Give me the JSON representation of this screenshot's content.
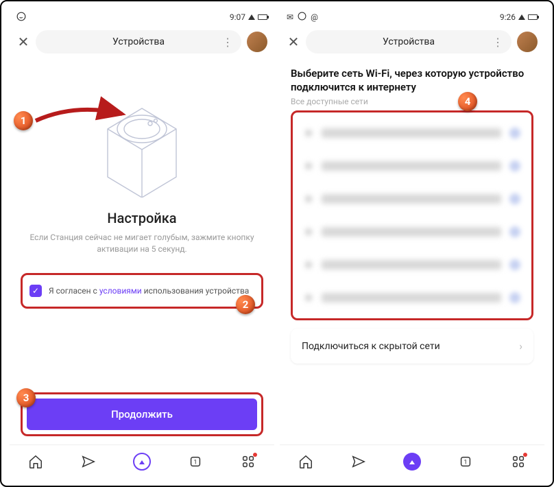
{
  "left": {
    "status_time": "9:07",
    "header_title": "Устройства",
    "setup_title": "Настройка",
    "setup_subtitle": "Если Станция сейчас не мигает голубым, зажмите кнопку активации на 5 секунд.",
    "terms_prefix": "Я согласен с ",
    "terms_link": "условиями",
    "terms_suffix": " использования устройства",
    "continue_label": "Продолжить"
  },
  "right": {
    "status_time": "9:26",
    "header_title": "Устройства",
    "wifi_heading": "Выберите сеть Wi-Fi, через которую устройство подключится к интернету",
    "wifi_sub": "Все доступные сети",
    "hidden_network_label": "Подключиться к скрытой сети"
  },
  "callouts": {
    "c1": "1",
    "c2": "2",
    "c3": "3",
    "c4": "4"
  }
}
